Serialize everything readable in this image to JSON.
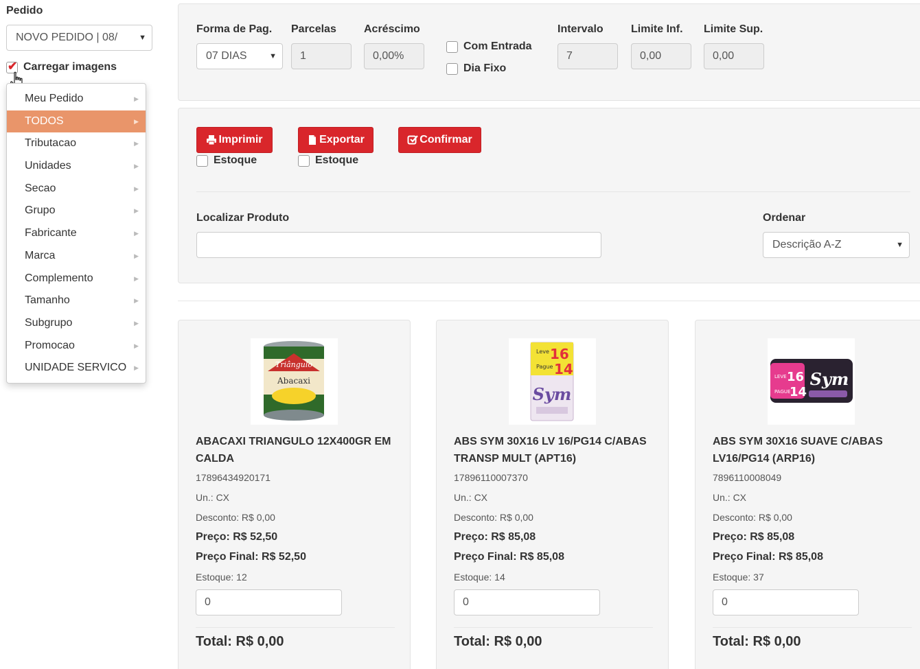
{
  "sidebar": {
    "pedido_label": "Pedido",
    "pedido_value": "NOVO PEDIDO | 08/",
    "carregar_label": "Carregar imagens",
    "carregar_checked": true,
    "menu": [
      {
        "label": "Meu Pedido"
      },
      {
        "label": "TODOS",
        "active": true
      },
      {
        "label": "Tributacao"
      },
      {
        "label": "Unidades"
      },
      {
        "label": "Secao"
      },
      {
        "label": "Grupo"
      },
      {
        "label": "Fabricante"
      },
      {
        "label": "Marca"
      },
      {
        "label": "Complemento"
      },
      {
        "label": "Tamanho"
      },
      {
        "label": "Subgrupo"
      },
      {
        "label": "Promocao"
      },
      {
        "label": "UNIDADE SERVICO"
      }
    ]
  },
  "payment": {
    "forma_label": "Forma de Pag.",
    "forma_value": "07 DIAS",
    "parcelas_label": "Parcelas",
    "parcelas_value": "1",
    "acrescimo_label": "Acréscimo",
    "acrescimo_value": "0,00%",
    "com_entrada_label": "Com Entrada",
    "dia_fixo_label": "Dia Fixo",
    "intervalo_label": "Intervalo",
    "intervalo_value": "7",
    "limite_inf_label": "Limite Inf.",
    "limite_inf_value": "0,00",
    "limite_sup_label": "Limite Sup.",
    "limite_sup_value": "0,00"
  },
  "actions": {
    "imprimir_label": "Imprimir",
    "exportar_label": "Exportar",
    "confirmar_label": "Confirmar",
    "estoque_label": "Estoque"
  },
  "search": {
    "localizar_label": "Localizar Produto",
    "localizar_value": "",
    "ordenar_label": "Ordenar",
    "ordenar_value": "Descrição A-Z"
  },
  "colors": {
    "accent_red": "#d9262b",
    "menu_active": "#e9956a"
  },
  "products": [
    {
      "name": "ABACAXI TRIANGULO 12X400GR EM CALDA",
      "code": "17896434920171",
      "unit": "Un.: CX",
      "discount": "Desconto: R$ 0,00",
      "price": "Preço: R$ 52,50",
      "final_price": "Preço Final: R$ 52,50",
      "stock": "Estoque: 12",
      "qty": "0",
      "total": "Total: R$ 0,00",
      "image_icon": "pineapple-can-image",
      "image_text": "Abacaxi"
    },
    {
      "name": "ABS SYM 30X16 LV 16/PG14 C/ABAS TRANSP MULT (APT16)",
      "code": "17896110007370",
      "unit": "Un.: CX",
      "discount": "Desconto: R$ 0,00",
      "price": "Preço: R$ 85,08",
      "final_price": "Preço Final: R$ 85,08",
      "stock": "Estoque: 14",
      "qty": "0",
      "total": "Total: R$ 0,00",
      "image_icon": "sym-pad-box-image",
      "image_text": "Sym"
    },
    {
      "name": "ABS SYM 30X16 SUAVE C/ABAS LV16/PG14 (ARP16)",
      "code": "7896110008049",
      "unit": "Un.: CX",
      "discount": "Desconto: R$ 0,00",
      "price": "Preço: R$ 85,08",
      "final_price": "Preço Final: R$ 85,08",
      "stock": "Estoque: 37",
      "qty": "0",
      "total": "Total: R$ 0,00",
      "image_icon": "sym-pad-pack-image",
      "image_text": "Sym"
    }
  ]
}
